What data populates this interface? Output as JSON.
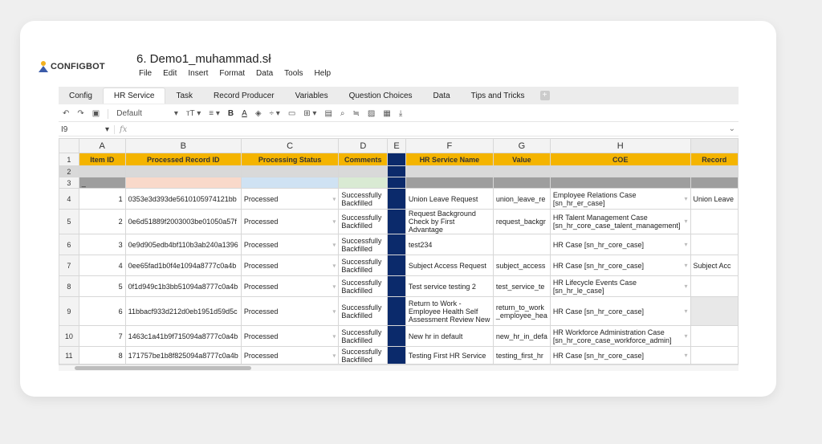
{
  "app": {
    "logo_text": "CONFIGBOT",
    "doc_title": "6. Demo1_muhammad.sł"
  },
  "menu": [
    "File",
    "Edit",
    "Insert",
    "Format",
    "Data",
    "Tools",
    "Help"
  ],
  "sheet_tabs": [
    "Config",
    "HR Service",
    "Task",
    "Record Producer",
    "Variables",
    "Question Choices",
    "Data",
    "Tips and Tricks"
  ],
  "active_tab": "HR Service",
  "toolbar": {
    "font": "Default",
    "bold": "B",
    "underline": "A"
  },
  "formula": {
    "cell_ref": "I9",
    "fx": "fx"
  },
  "columns": [
    "A",
    "B",
    "C",
    "D",
    "E",
    "F",
    "G",
    "H"
  ],
  "headers": [
    "Item ID",
    "Processed Record ID",
    "Processing Status",
    "Comments",
    "",
    "HR Service Name",
    "Value",
    "COE",
    "Record"
  ],
  "rows": [
    {
      "n": "4",
      "id": "1",
      "rec": "0353e3d393de5610105974121bb",
      "status": "Processed",
      "comment": "Successfully Backfilled",
      "name": "Union Leave Request",
      "value": "union_leave_re",
      "coe": "Employee Relations Case [sn_hr_er_case]",
      "extra": "Union Leave"
    },
    {
      "n": "5",
      "id": "2",
      "rec": "0e6d51889f2003003be01050a57f",
      "status": "Processed",
      "comment": "Successfully Backfilled",
      "name": "Request Background Check by First Advantage",
      "value": "request_backgr",
      "coe": "HR Talent Management Case [sn_hr_core_case_talent_management]",
      "extra": ""
    },
    {
      "n": "6",
      "id": "3",
      "rec": "0e9d905edb4bf110b3ab240a1396",
      "status": "Processed",
      "comment": "Successfully Backfilled",
      "name": "test234",
      "value": "",
      "coe": "HR Case [sn_hr_core_case]",
      "extra": ""
    },
    {
      "n": "7",
      "id": "4",
      "rec": "0ee65fad1b0f4e1094a8777c0a4b",
      "status": "Processed",
      "comment": "Successfully Backfilled",
      "name": "Subject Access Request",
      "value": "subject_access",
      "coe": "HR Case [sn_hr_core_case]",
      "extra": "Subject Acc"
    },
    {
      "n": "8",
      "id": "5",
      "rec": "0f1d949c1b3bb51094a8777c0a4b",
      "status": "Processed",
      "comment": "Successfully Backfilled",
      "name": "Test service testing 2",
      "value": "test_service_te",
      "coe": "HR Lifecycle Events Case [sn_hr_le_case]",
      "extra": ""
    },
    {
      "n": "9",
      "id": "6",
      "rec": "11bbacf933d212d0eb1951d59d5c",
      "status": "Processed",
      "comment": "Successfully Backfilled",
      "name": "Return to Work - Employee Health Self Assessment Review New",
      "value": "return_to_work _employee_hea",
      "coe": "HR Case [sn_hr_core_case]",
      "extra": ""
    },
    {
      "n": "10",
      "id": "7",
      "rec": "1463c1a41b9f715094a8777c0a4b",
      "status": "Processed",
      "comment": "Successfully Backfilled",
      "name": "New hr in default",
      "value": "new_hr_in_defa",
      "coe": "HR Workforce Administration Case [sn_hr_core_case_workforce_admin]",
      "extra": ""
    },
    {
      "n": "11",
      "id": "8",
      "rec": "171757be1b8f825094a8777c0a4b",
      "status": "Processed",
      "comment": "Successfully Backfilled",
      "name": "Testing First HR Service",
      "value": "testing_first_hr",
      "coe": "HR Case [sn_hr_core_case]",
      "extra": ""
    }
  ]
}
